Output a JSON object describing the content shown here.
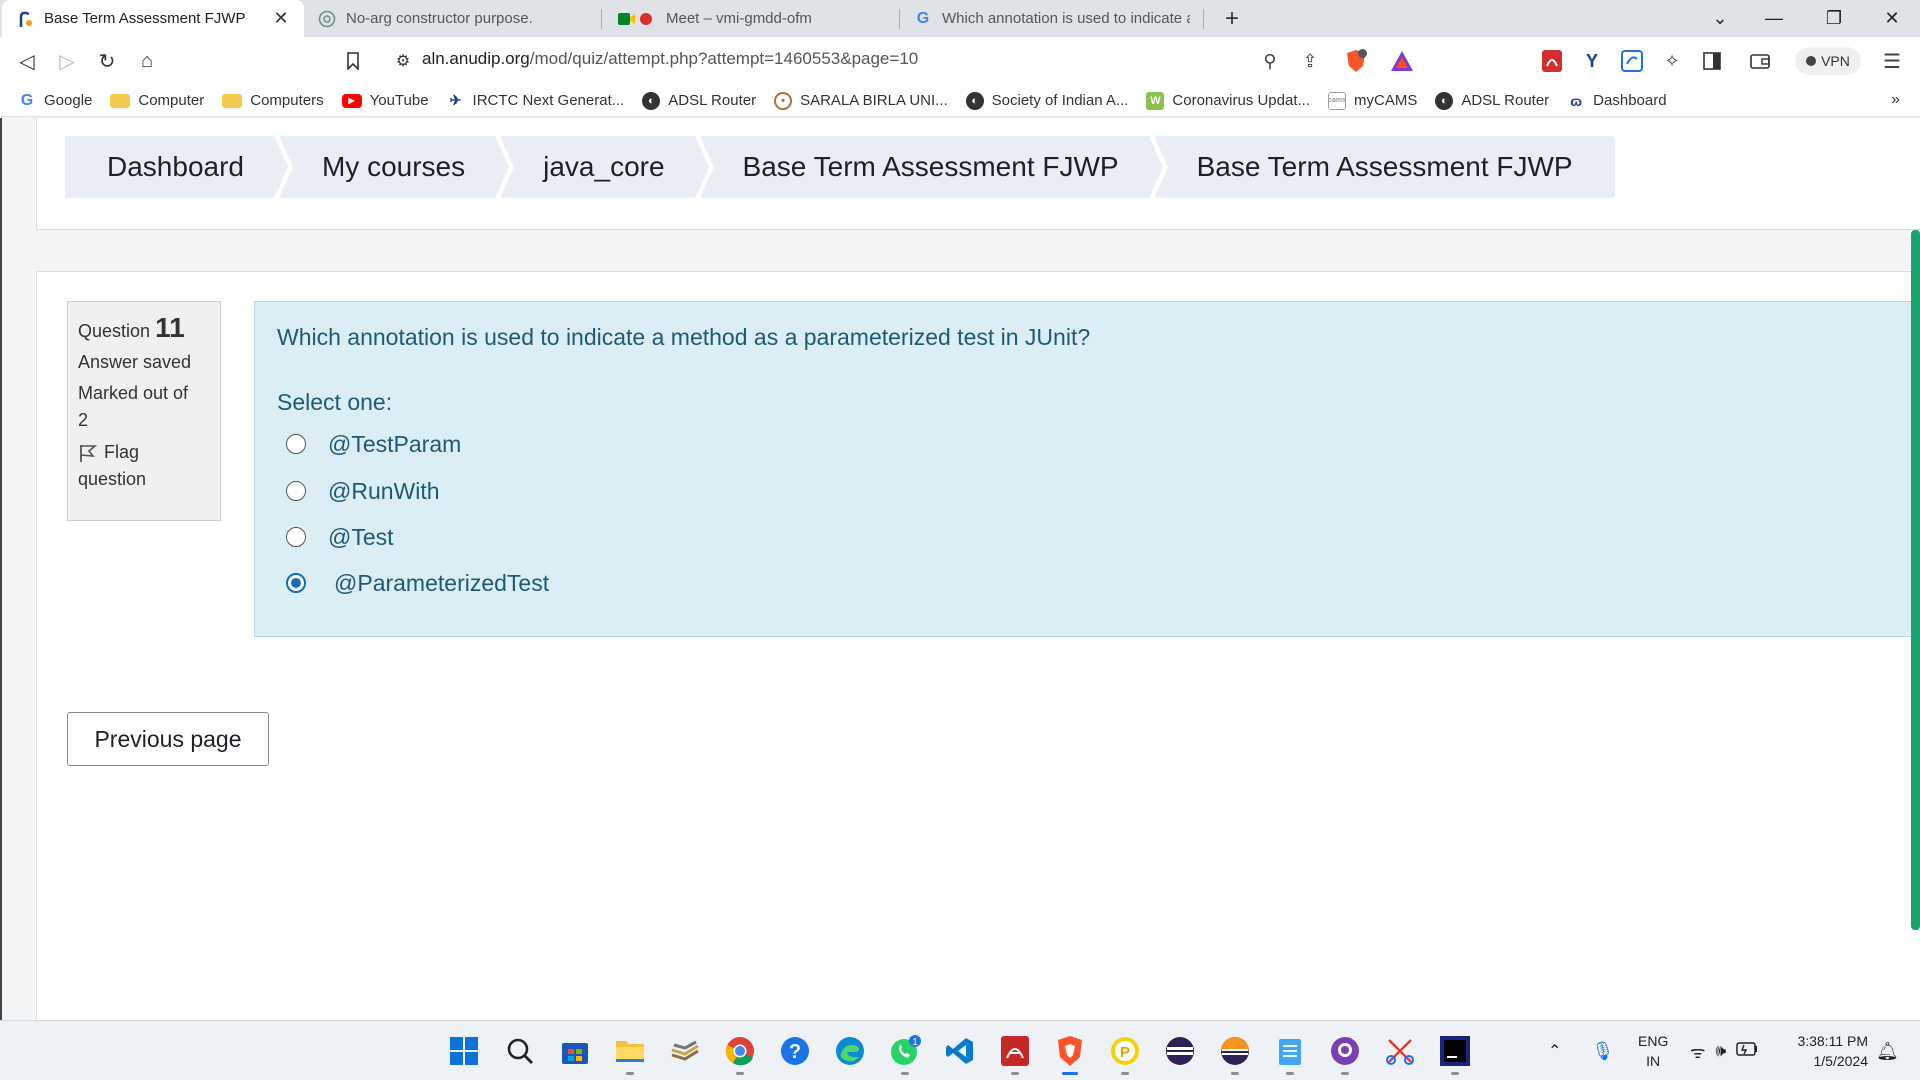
{
  "browser": {
    "tabs": [
      {
        "title": "Base Term Assessment FJWP",
        "icon": "moodle-icon",
        "active": true
      },
      {
        "title": "No-arg constructor purpose.",
        "icon": "chatgpt-icon",
        "active": false
      },
      {
        "title": "Meet – vmi-gmdd-ofm",
        "icon": "meet-icon",
        "active": false
      },
      {
        "title": "Which annotation is used to indicate a",
        "icon": "google-icon",
        "active": false
      }
    ],
    "url": {
      "domain": "aln.anudip.org",
      "path": "/mod/quiz/attempt.php?attempt=1460553&page=10"
    },
    "vpn_label": "VPN",
    "bookmarks": [
      {
        "label": "Google",
        "icon": "google-icon",
        "color": "#4285f4"
      },
      {
        "label": "Computer",
        "icon": "folder-icon",
        "color": "#f2c94c"
      },
      {
        "label": "Computers",
        "icon": "folder-icon",
        "color": "#f2c94c"
      },
      {
        "label": "YouTube",
        "icon": "youtube-icon",
        "color": "#ff0000"
      },
      {
        "label": "IRCTC Next Generat...",
        "icon": "irctc-icon",
        "color": "#1a3f8f"
      },
      {
        "label": "ADSL Router",
        "icon": "globe-icon",
        "color": "#333333"
      },
      {
        "label": "SARALA BIRLA UNI...",
        "icon": "university-icon",
        "color": "#b07040"
      },
      {
        "label": "Society of Indian A...",
        "icon": "globe-icon",
        "color": "#333333"
      },
      {
        "label": "Coronavirus Updat...",
        "icon": "worldometer-icon",
        "color": "#8bc34a"
      },
      {
        "label": "myCAMS",
        "icon": "cams-icon",
        "color": "#9aa0a6"
      },
      {
        "label": "ADSL Router",
        "icon": "globe-icon",
        "color": "#333333"
      },
      {
        "label": "Dashboard",
        "icon": "moodle-icon",
        "color": "#2a3a8f"
      }
    ],
    "bookmarks_more": "»"
  },
  "page": {
    "breadcrumb": [
      "Dashboard",
      "My courses",
      "java_core",
      "Base Term Assessment FJWP",
      "Base Term Assessment FJWP"
    ],
    "question_info": {
      "question_label": "Question",
      "question_number": "11",
      "status": "Answer saved",
      "marks_line1": "Marked out of",
      "marks_line2": "2",
      "flag_line1": "Flag",
      "flag_line2": "question"
    },
    "question": {
      "text": "Which annotation is used to indicate a method as a parameterized test in JUnit?",
      "prompt": "Select one:",
      "options": [
        {
          "label": "@TestParam",
          "selected": false
        },
        {
          "label": "@RunWith",
          "selected": false
        },
        {
          "label": "@Test",
          "selected": false
        },
        {
          "label": "@ParameterizedTest",
          "selected": true
        }
      ]
    },
    "previous_button": "Previous page",
    "accent_color": "#0f6cbf"
  },
  "taskbar": {
    "apps": [
      "windows-start-icon",
      "search-icon",
      "microsoft-store-icon",
      "file-explorer-icon",
      "stack-icon",
      "chrome-icon",
      "help-icon",
      "edge-icon",
      "whatsapp-icon",
      "vscode-icon",
      "acrobat-icon",
      "brave-icon",
      "pdf-reader-icon",
      "eclipse-icon",
      "eclipse-alt-icon",
      "notepad-icon",
      "github-icon",
      "snipping-icon",
      "intellij-icon"
    ],
    "whatsapp_badge": "1",
    "language": {
      "line1": "ENG",
      "line2": "IN"
    },
    "time": "3:38:11 PM",
    "date": "1/5/2024"
  }
}
